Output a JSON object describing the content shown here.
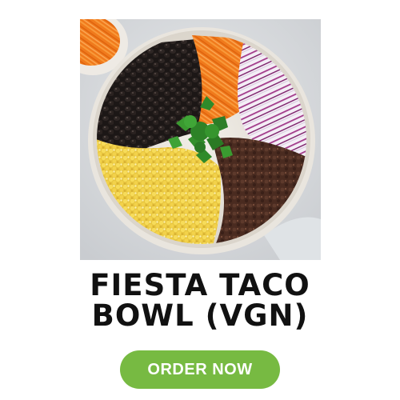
{
  "product": {
    "title_line1": "FIESTA TACO",
    "title_line2": "BOWL (VGN)",
    "image_subject": "taco bowl with black beans, carrots, cabbage, cilantro, corn and seasoned crumbles"
  },
  "cta": {
    "label": "ORDER NOW"
  },
  "colors": {
    "button": "#77ba42",
    "title": "#111111",
    "background": "#ffffff"
  }
}
